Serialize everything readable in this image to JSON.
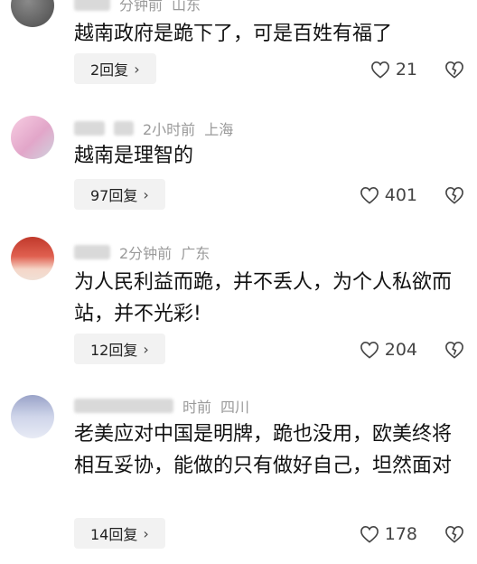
{
  "comments": [
    {
      "time": "分钟前",
      "location": "山东",
      "text": "越南政府是跪下了，可是百姓有福了",
      "reply_label": "2回复",
      "likes": "21"
    },
    {
      "time": "2小时前",
      "location": "上海",
      "text": "越南是理智的",
      "reply_label": "97回复",
      "likes": "401"
    },
    {
      "time": "2分钟前",
      "location": "广东",
      "text": "为人民利益而跪，并不丢人，为个人私欲而站，并不光彩!",
      "reply_label": "12回复",
      "likes": "204"
    },
    {
      "time": "时前",
      "location": "四川",
      "text": "老美应对中国是明牌，跪也没用，欧美终将相互妥协，能做的只有做好自己，坦然面对",
      "reply_label": "14回复",
      "likes": "178"
    }
  ],
  "icons": {
    "reply_chevron": "chevron-right-icon",
    "like": "heart-icon",
    "dislike": "broken-heart-icon"
  },
  "colors": {
    "text": "#111111",
    "meta": "#9a9a9a",
    "reply_bg": "#f2f2f2",
    "icon": "#444444"
  }
}
